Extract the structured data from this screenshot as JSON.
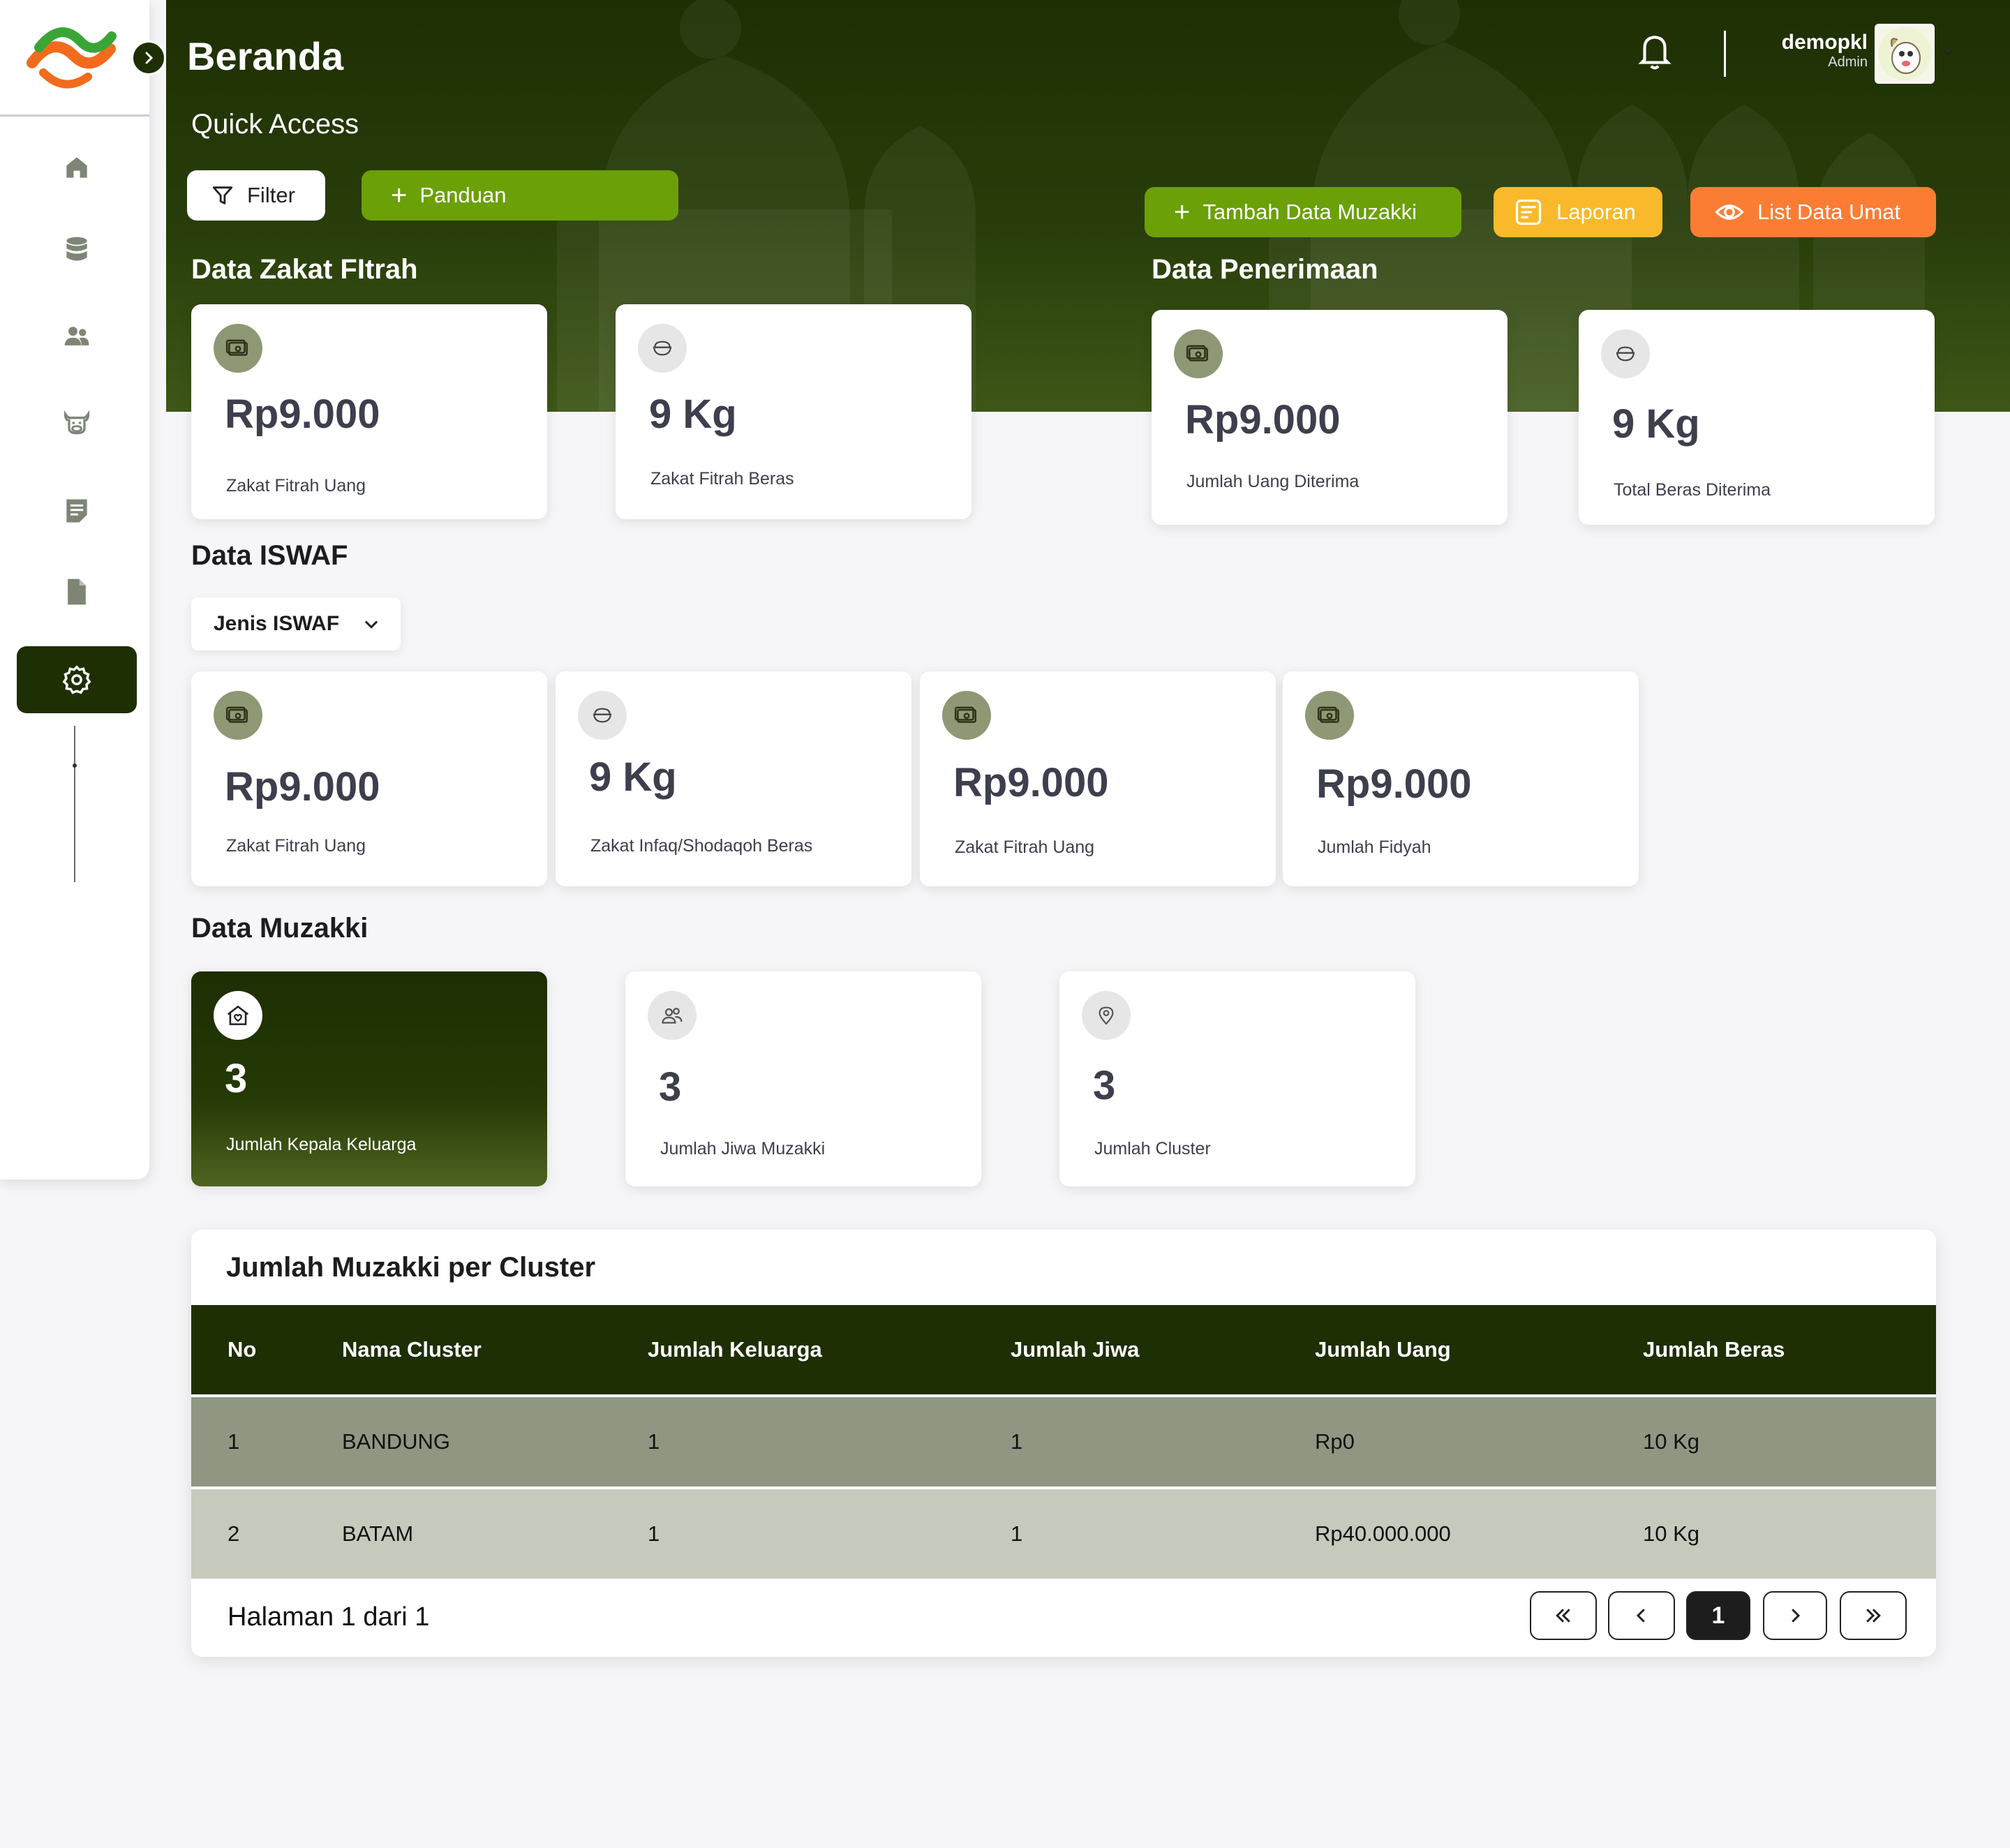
{
  "header": {
    "title": "Beranda",
    "quick_access": "Quick Access",
    "user": {
      "name": "demopkl",
      "role": "Admin"
    }
  },
  "actions": {
    "filter": "Filter",
    "panduan": "Panduan",
    "tambah": "Tambah Data Muzakki",
    "laporan": "Laporan",
    "list_umat": "List Data Umat"
  },
  "sections": {
    "zakat_fitrah": "Data Zakat FItrah",
    "penerimaan": "Data Penerimaan",
    "iswaf": "Data ISWAF",
    "muzakki": "Data Muzakki"
  },
  "zakat_cards": [
    {
      "value": "Rp9.000",
      "label": "Zakat Fitrah Uang",
      "icon": "money-icon"
    },
    {
      "value": "9 Kg",
      "label": "Zakat Fitrah Beras",
      "icon": "rice-bowl-icon"
    }
  ],
  "penerimaan_cards": [
    {
      "value": "Rp9.000",
      "label": "Jumlah Uang Diterima",
      "icon": "money-icon"
    },
    {
      "value": "9 Kg",
      "label": "Total Beras Diterima",
      "icon": "rice-bowl-icon"
    }
  ],
  "iswaf_select": {
    "label": "Jenis ISWAF"
  },
  "iswaf_cards": [
    {
      "value": "Rp9.000",
      "label": "Zakat Fitrah Uang",
      "icon": "money-icon"
    },
    {
      "value": "9 Kg",
      "label": "Zakat Infaq/Shodaqoh Beras",
      "icon": "rice-bowl-icon"
    },
    {
      "value": "Rp9.000",
      "label": "Zakat Fitrah Uang",
      "icon": "money-icon"
    },
    {
      "value": "Rp9.000",
      "label": "Jumlah Fidyah",
      "icon": "money-icon"
    }
  ],
  "muzakki_cards": [
    {
      "value": "3",
      "label": "Jumlah Kepala Keluarga",
      "icon": "home-heart-icon"
    },
    {
      "value": "3",
      "label": "Jumlah Jiwa Muzakki",
      "icon": "people-icon"
    },
    {
      "value": "3",
      "label": "Jumlah Cluster",
      "icon": "location-pin-icon"
    }
  ],
  "table": {
    "title": "Jumlah Muzakki per Cluster",
    "columns": [
      "No",
      "Nama Cluster",
      "Jumlah Keluarga",
      "Jumlah Jiwa",
      "Jumlah Uang",
      "Jumlah Beras"
    ],
    "rows": [
      [
        "1",
        "BANDUNG",
        "1",
        "1",
        "Rp0",
        "10 Kg"
      ],
      [
        "2",
        "BATAM",
        "1",
        "1",
        "Rp40.000.000",
        "10 Kg"
      ]
    ],
    "pagination": {
      "text": "Halaman 1 dari 1",
      "current": "1"
    }
  },
  "sidebar": {
    "items": [
      "home-icon",
      "database-icon",
      "users-icon",
      "cow-icon",
      "note-icon",
      "file-icon",
      "settings-icon"
    ],
    "active": "settings-icon"
  },
  "colors": {
    "primary_dark": "#1e2f04",
    "green": "#6ba007",
    "yellow": "#f9b92a",
    "orange": "#fb7d34",
    "row_1": "#8f9783",
    "row_2": "#c6cabd"
  }
}
